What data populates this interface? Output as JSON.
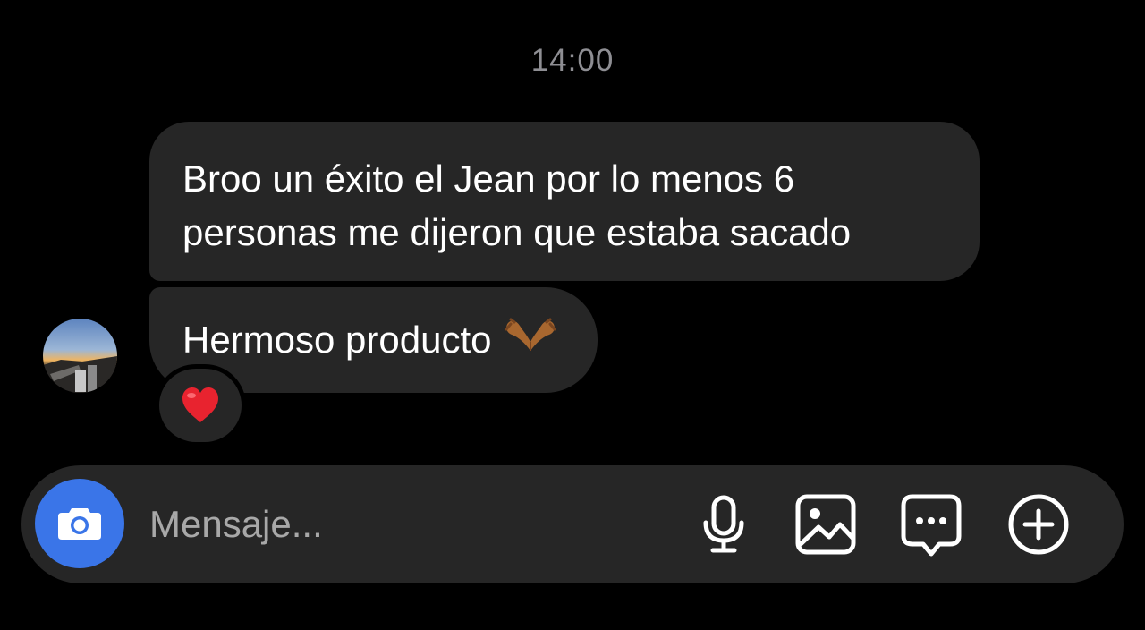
{
  "thread": {
    "timestamp": "14:00",
    "messages": [
      {
        "lines": [
          "Broo un éxito el Jean por lo menos 6",
          "personas me dijeron que estaba sacado"
        ]
      },
      {
        "text": "Hermoso producto",
        "emoji_icon": "heart-hands-emoji",
        "reaction_icon": "red-heart-emoji"
      }
    ]
  },
  "composer": {
    "placeholder": "Mensaje...",
    "buttons": [
      "camera-icon",
      "microphone-icon",
      "gallery-icon",
      "sticker-icon",
      "plus-icon"
    ],
    "camera_button_color": "#3a75e8"
  },
  "colors": {
    "background": "#000000",
    "bubble": "#262626",
    "text": "#ffffff",
    "timestamp": "#8e8e93",
    "placeholder": "#a8a8a8"
  }
}
